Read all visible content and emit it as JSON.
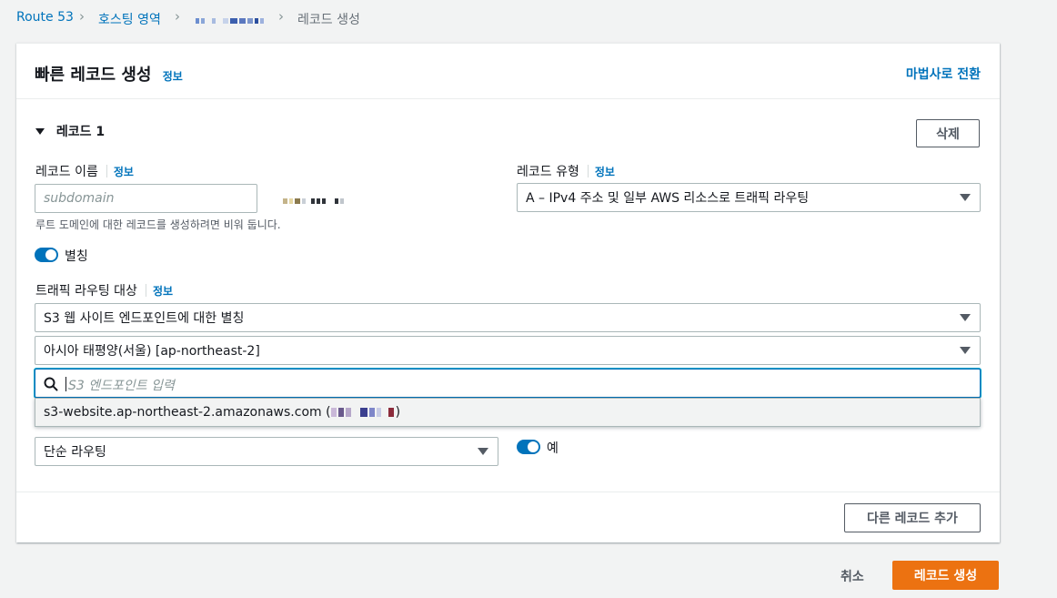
{
  "breadcrumb": {
    "root": "Route 53",
    "hosted_zones": "호스팅 영역",
    "current": "레코드 생성"
  },
  "panel": {
    "title": "빠른 레코드 생성",
    "info": "정보",
    "wizard_link": "마법사로 전환"
  },
  "record": {
    "header": "레코드 1",
    "delete_button": "삭제",
    "name_label": "레코드 이름",
    "name_info": "정보",
    "name_placeholder": "subdomain",
    "name_hint": "루트 도메인에 대한 레코드를 생성하려면 비워 둡니다.",
    "type_label": "레코드 유형",
    "type_info": "정보",
    "type_value": "A – IPv4 주소 및 일부 AWS 리소스로 트래픽 라우팅",
    "alias_label": "별칭",
    "alias_enabled": true,
    "target_label": "트래픽 라우팅 대상",
    "target_info": "정보",
    "target_value": "S3 웹 사이트 엔드포인트에 대한 별칭",
    "region_value": "아시아 태평양(서울) [ap-northeast-2]",
    "endpoint_placeholder": "S3 엔드포인트 입력",
    "endpoint_option": "s3-website.ap-northeast-2.amazonaws.com (",
    "endpoint_option_suffix": ")",
    "routing_value": "단순 라우팅",
    "health_value": "예",
    "health_enabled": true
  },
  "footer": {
    "add_record": "다른 레코드 추가",
    "cancel": "취소",
    "create": "레코드 생성"
  },
  "colors": {
    "link": "#0073bb",
    "primary": "#ec7211",
    "toggle_on": "#0073bb"
  }
}
